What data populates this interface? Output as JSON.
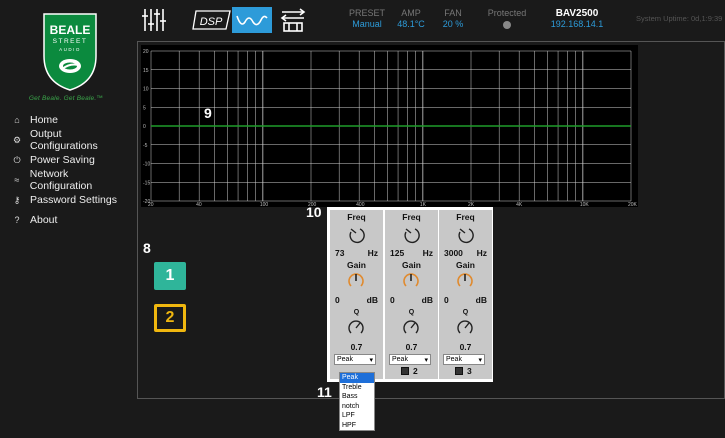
{
  "brand": {
    "line1": "BEALE",
    "line2": "STREET",
    "line3": "AUDIO",
    "tagline": "Get Beale. Get Beale.™",
    "colors": {
      "logo_green": "#0b8a3e",
      "tagline": "#3aa54a"
    }
  },
  "nav": {
    "items": [
      {
        "icon": "home-icon",
        "glyph": "⌂",
        "label": "Home"
      },
      {
        "icon": "gear-icon",
        "glyph": "⚙",
        "label": "Output Configurations"
      },
      {
        "icon": "power-icon",
        "glyph": "⏻",
        "label": "Power Saving"
      },
      {
        "icon": "wifi-icon",
        "glyph": "≈",
        "label": "Network Configuration"
      },
      {
        "icon": "key-icon",
        "glyph": "⚷",
        "label": "Password Settings"
      },
      {
        "icon": "question-icon",
        "glyph": "?",
        "label": "About"
      }
    ]
  },
  "toolbar": {
    "mixer_icon": "mixer-sliders-icon",
    "dsp_label": "DSP",
    "eq_icon": "eq-curve-icon",
    "routing_icon": "routing-icon",
    "active_color": "#2d9bd9"
  },
  "status": {
    "preset_label": "PRESET",
    "preset_value": "Manual",
    "amp_label": "AMP",
    "amp_value": "48.1°C",
    "fan_label": "FAN",
    "fan_value": "20 %",
    "protected_label": "Protected",
    "model": "BAV2500",
    "ip": "192.168.14.1",
    "uptime": "System Uptime: 0d,1:9:39",
    "value_color": "#2d9bd9"
  },
  "graph": {
    "y_ticks": [
      "20",
      "15",
      "10",
      "5",
      "0",
      "-5",
      "-10",
      "-15",
      "-20"
    ],
    "x_ticks": [
      "20",
      "40",
      "100",
      "200",
      "400",
      "1K",
      "2K",
      "4K",
      "10K",
      "20K"
    ],
    "y_range": [
      -20,
      20
    ],
    "x_range": [
      20,
      20000
    ],
    "x_scale": "log",
    "response_db": 0,
    "curve_color": "#1f9e2a"
  },
  "annotations": {
    "graph": "9",
    "filters": "10",
    "presets": "8",
    "dropdown": "11"
  },
  "presets": [
    {
      "label": "1",
      "color": "#2fb59a"
    },
    {
      "label": "2",
      "color": "#f0b70f"
    }
  ],
  "filters": [
    {
      "freq_label": "Freq",
      "freq": "73",
      "freq_unit": "Hz",
      "gain_label": "Gain",
      "gain": "0",
      "gain_unit": "dB",
      "q_label": "Q",
      "q": "0.7",
      "type": "Peak",
      "number": ""
    },
    {
      "freq_label": "Freq",
      "freq": "125",
      "freq_unit": "Hz",
      "gain_label": "Gain",
      "gain": "0",
      "gain_unit": "dB",
      "q_label": "Q",
      "q": "0.7",
      "type": "Peak",
      "number": "2"
    },
    {
      "freq_label": "Freq",
      "freq": "3000",
      "freq_unit": "Hz",
      "gain_label": "Gain",
      "gain": "0",
      "gain_unit": "dB",
      "q_label": "Q",
      "q": "0.7",
      "type": "Peak",
      "number": "3"
    }
  ],
  "dropdown": {
    "options": [
      "Peak",
      "Treble",
      "Bass",
      "notch",
      "LPF",
      "HPF"
    ],
    "selected": "Peak",
    "highlight_color": "#1e6fd9"
  }
}
